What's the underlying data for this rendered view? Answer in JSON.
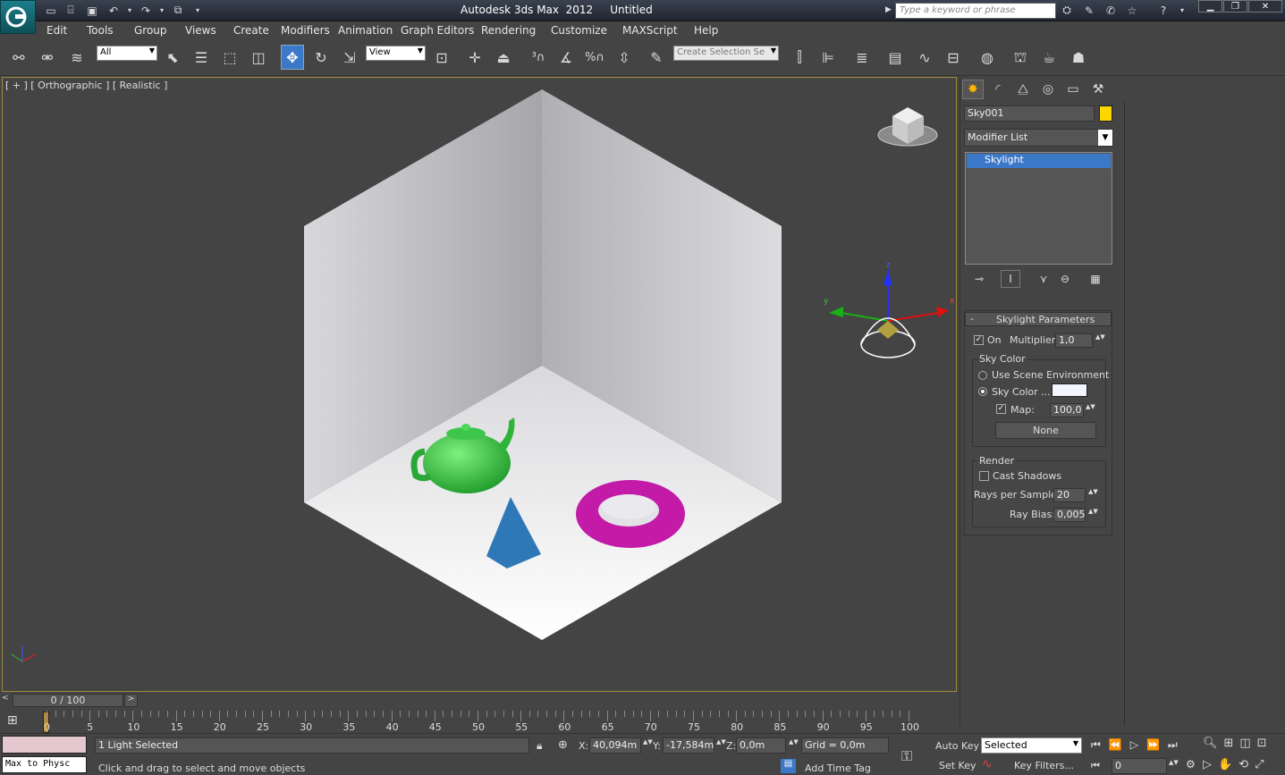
{
  "window": {
    "title": "Autodesk 3ds Max  2012     Untitled",
    "search_placeholder": "Type a keyword or phrase"
  },
  "menu": [
    "Edit",
    "Tools",
    "Group",
    "Views",
    "Create",
    "Modifiers",
    "Animation",
    "Graph Editors",
    "Rendering",
    "Customize",
    "MAXScript",
    "Help"
  ],
  "toolbar": {
    "filter_value": "All",
    "refcoord_value": "View",
    "selection_set_placeholder": "Create Selection Se"
  },
  "viewport": {
    "label": "[ + ] [ Orthographic ] [ Realistic ]"
  },
  "command_panel": {
    "object_name": "Sky001",
    "object_color": "#ffd700",
    "modifier_list": "Modifier List",
    "stack_items": [
      "Skylight"
    ],
    "rollout_title": "Skylight Parameters",
    "on_label": "On",
    "multiplier_label": "Multiplier:",
    "multiplier_value": "1,0",
    "sky_color_group": "Sky Color",
    "use_scene_env_label": "Use Scene Environment",
    "sky_color_label": "Sky Color ...",
    "map_label": "Map:",
    "map_value": "100,0",
    "map_button": "None",
    "render_group": "Render",
    "cast_shadows_label": "Cast Shadows",
    "rays_label": "Rays per Sample:",
    "rays_value": "20",
    "ray_bias_label": "Ray Bias:",
    "ray_bias_value": "0,005"
  },
  "timeline": {
    "slider_text": "0 / 100",
    "ticks": [
      "0",
      "5",
      "10",
      "15",
      "20",
      "25",
      "30",
      "35",
      "40",
      "45",
      "50",
      "55",
      "60",
      "65",
      "70",
      "75",
      "80",
      "85",
      "90",
      "95",
      "100"
    ]
  },
  "status": {
    "maxscript_text": "Max to Physc",
    "selection_info": "1 Light Selected",
    "prompt": "Click and drag to select and move objects",
    "x_label": "X:",
    "x_value": "40,094m",
    "y_label": "Y:",
    "y_value": "-17,584m",
    "z_label": "Z:",
    "z_value": "0,0m",
    "grid": "Grid = 0,0m",
    "add_time_tag": "Add Time Tag",
    "auto_key": "Auto Key",
    "set_key": "Set Key",
    "key_mode_value": "Selected",
    "key_filters": "Key Filters...",
    "frame_value": "0"
  }
}
